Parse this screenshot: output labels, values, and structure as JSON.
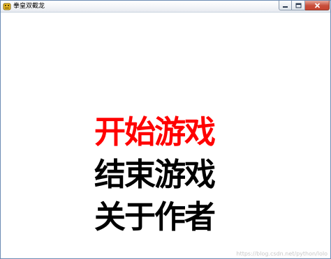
{
  "window": {
    "title": "拳皇双截龙",
    "icon": "game-app-icon"
  },
  "colors": {
    "selected": "#ff0000",
    "normal": "#000000",
    "background": "#ffffff"
  },
  "menu": {
    "items": [
      {
        "label": "开始游戏",
        "selected": true
      },
      {
        "label": "结束游戏",
        "selected": false
      },
      {
        "label": "关于作者",
        "selected": false
      }
    ]
  },
  "watermark": "https://blog.csdn.net/python/lolo"
}
